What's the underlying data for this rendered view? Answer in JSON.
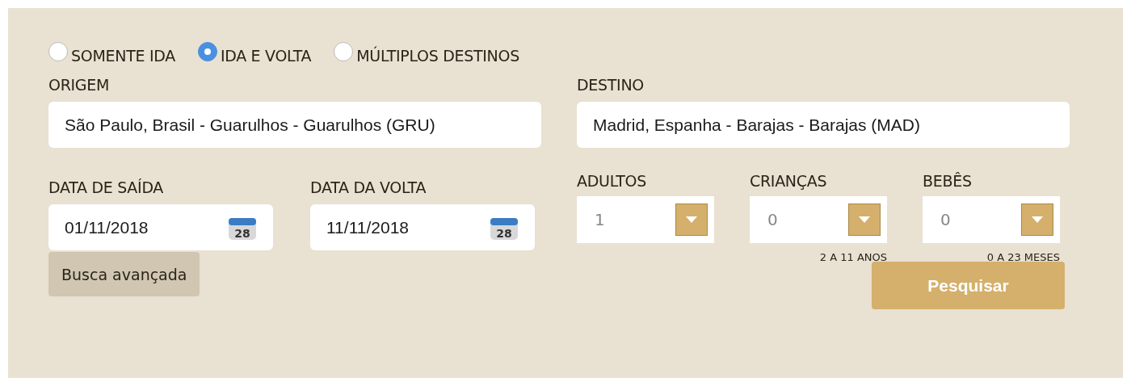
{
  "trip_types": [
    {
      "label": "SOMENTE IDA",
      "selected": false
    },
    {
      "label": "IDA E VOLTA",
      "selected": true
    },
    {
      "label": "MÚLTIPLOS DESTINOS",
      "selected": false
    }
  ],
  "origin": {
    "label": "ORIGEM",
    "value": "São Paulo, Brasil - Guarulhos - Guarulhos (GRU)"
  },
  "destination": {
    "label": "DESTINO",
    "value": "Madrid, Espanha - Barajas - Barajas (MAD)"
  },
  "dates": [
    {
      "label": "DATA DE SAÍDA",
      "value": "01/11/2018",
      "calendar_day": "28"
    },
    {
      "label": "DATA DA VOLTA",
      "value": "11/11/2018",
      "calendar_day": "28"
    }
  ],
  "passengers": [
    {
      "label": "ADULTOS",
      "value": "1"
    },
    {
      "label": "CRIANÇAS",
      "value": "0",
      "hint": "2 A 11 ANOS"
    },
    {
      "label": "BEBÊS",
      "value": "0",
      "hint": "0 A 23 MESES"
    }
  ],
  "advanced_button": "Busca avançada",
  "search_button": "Pesquisar"
}
